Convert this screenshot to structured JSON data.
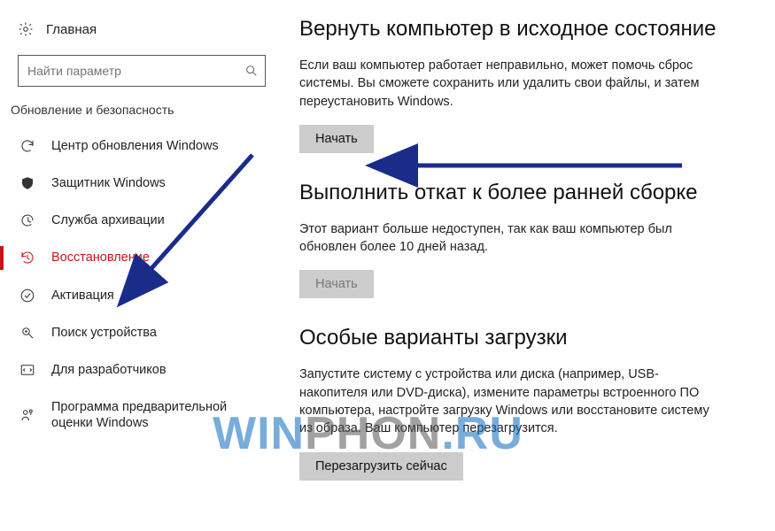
{
  "sidebar": {
    "home_label": "Главная",
    "search_placeholder": "Найти параметр",
    "section_label": "Обновление и безопасность",
    "items": [
      {
        "label": "Центр обновления Windows"
      },
      {
        "label": "Защитник Windows"
      },
      {
        "label": "Служба архивации"
      },
      {
        "label": "Восстановление"
      },
      {
        "label": "Активация"
      },
      {
        "label": "Поиск устройства"
      },
      {
        "label": "Для разработчиков"
      },
      {
        "label": "Программа предварительной оценки Windows"
      }
    ],
    "active_index": 3
  },
  "main": {
    "sections": [
      {
        "title": "Вернуть компьютер в исходное состояние",
        "desc": "Если ваш компьютер работает неправильно, может помочь сброс системы. Вы сможете сохранить или удалить свои файлы, и затем переустановить Windows.",
        "button_label": "Начать",
        "button_disabled": false
      },
      {
        "title": "Выполнить откат к более ранней сборке",
        "desc": "Этот вариант больше недоступен, так как ваш компьютер был обновлен более 10 дней назад.",
        "button_label": "Начать",
        "button_disabled": true
      },
      {
        "title": "Особые варианты загрузки",
        "desc": "Запустите систему с устройства или диска (например, USB-накопителя или DVD-диска), измените параметры встроенного ПО компьютера, настройте загрузку Windows или восстановите систему из образа. Ваш компьютер перезагрузится.",
        "button_label": "Перезагрузить сейчас",
        "button_disabled": false
      }
    ]
  },
  "watermark": {
    "pre": "WIN",
    "mid": "PHON",
    "suf": ".RU"
  },
  "colors": {
    "accent": "#c41818",
    "arrow": "#1a2c8a"
  }
}
